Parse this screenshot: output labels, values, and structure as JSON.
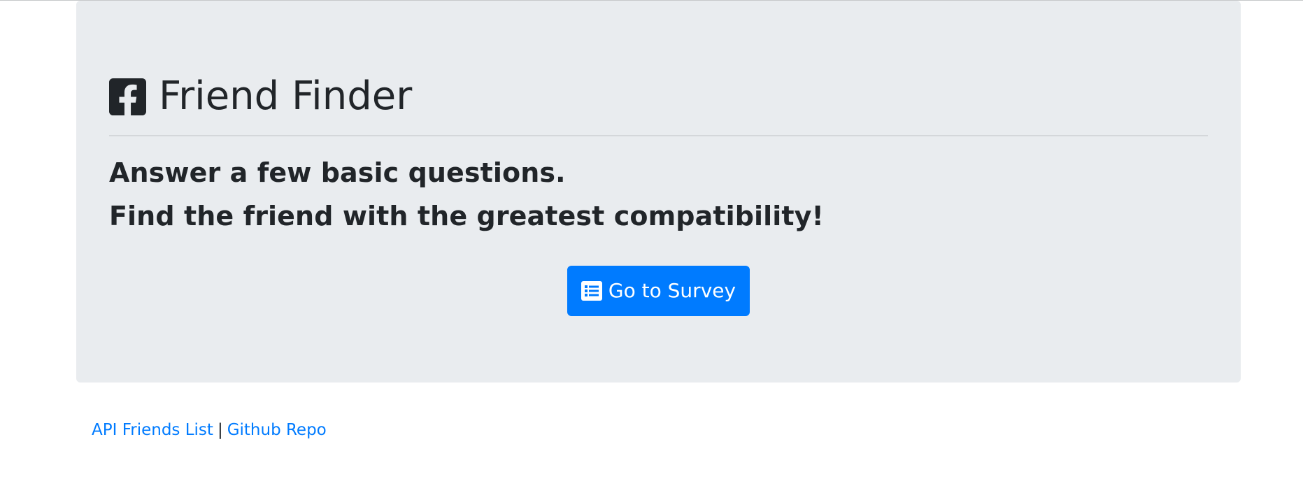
{
  "jumbotron": {
    "title": "Friend Finder",
    "title_icon": "facebook-square-icon",
    "lead_line_1": "Answer a few basic questions.",
    "lead_line_2": "Find the friend with the greatest compatibility!",
    "button": {
      "label": "Go to Survey",
      "icon": "list-alt-icon"
    }
  },
  "footer": {
    "link_api": "API Friends List",
    "separator": "|",
    "link_github": "Github Repo"
  },
  "colors": {
    "jumbotron_bg": "#e9ecef",
    "primary": "#007bff",
    "text": "#212529",
    "link": "#007bff"
  }
}
